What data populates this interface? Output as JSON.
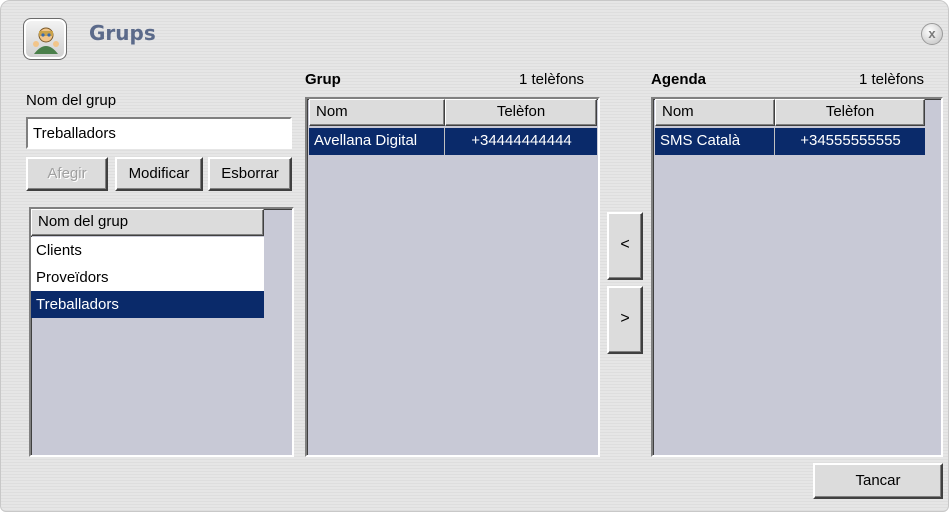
{
  "window": {
    "title": "Grups",
    "close_glyph": "x"
  },
  "left": {
    "group_name_label": "Nom del grup",
    "group_name_value": "Treballadors",
    "buttons": {
      "add": "Afegir",
      "modify": "Modificar",
      "delete": "Esborrar"
    },
    "list_header": "Nom del grup",
    "groups": [
      "Clients",
      "Proveïdors",
      "Treballadors"
    ],
    "selected_index": 2
  },
  "group_panel": {
    "title": "Grup",
    "count": "1 telèfons",
    "columns": [
      "Nom",
      "Telèfon"
    ],
    "rows": [
      {
        "name": "Avellana Digital",
        "phone": "+34444444444"
      }
    ]
  },
  "agenda_panel": {
    "title": "Agenda",
    "count": "1 telèfons",
    "columns": [
      "Nom",
      "Telèfon"
    ],
    "rows": [
      {
        "name": "SMS Català",
        "phone": "+34555555555"
      }
    ]
  },
  "transfer": {
    "left": "<",
    "right": ">"
  },
  "footer": {
    "close_label": "Tancar"
  },
  "colors": {
    "selection": "#0a2a6a",
    "panel_bg": "#c8c9d6",
    "title": "#5b6a8a"
  },
  "icons": {
    "app": "group-people-icon",
    "close": "close-icon"
  }
}
